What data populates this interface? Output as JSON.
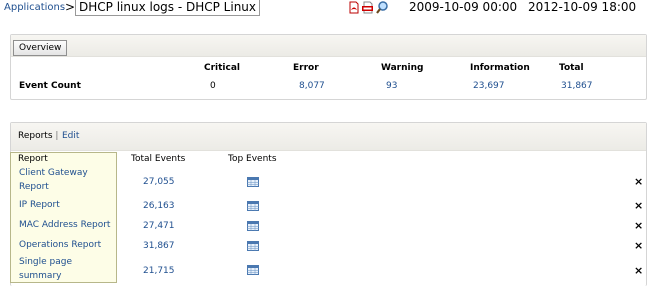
{
  "breadcrumb": {
    "app": "Applications",
    "separator": ">",
    "title": "DHCP linux logs - DHCP Linux"
  },
  "toolbar": {
    "icons": [
      "pdf-icon",
      "csv-icon",
      "search-icon"
    ]
  },
  "date_range": {
    "start": "2009-10-09 00:00",
    "end": "2012-10-09 18:00"
  },
  "overview": {
    "tab_label": "Overview",
    "columns": [
      "Critical",
      "Error",
      "Warning",
      "Information",
      "Total"
    ],
    "row_label": "Event Count",
    "values": [
      "0",
      "8,077",
      "93",
      "23,697",
      "31,867"
    ]
  },
  "reports": {
    "label": "Reports",
    "separator": "|",
    "edit_label": "Edit",
    "list_header": "Report",
    "columns": [
      "Total Events",
      "Top Events"
    ],
    "rows": [
      {
        "name": "Client Gateway Report",
        "total": "27,055"
      },
      {
        "name": "IP Report",
        "total": "26,163"
      },
      {
        "name": "MAC Address Report",
        "total": "27,471"
      },
      {
        "name": "Operations Report",
        "total": "31,867"
      },
      {
        "name": "Single page summary",
        "total": "21,715"
      }
    ],
    "remove_glyph": "×"
  },
  "colors": {
    "link": "#1f4f8f",
    "panel_header": "#ecebe6",
    "list_bg": "#fdfde7"
  }
}
